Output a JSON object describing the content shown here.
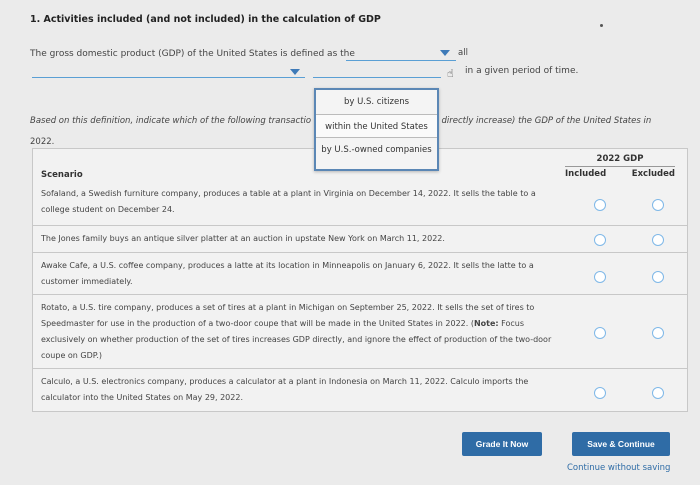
{
  "question": {
    "title": "1. Activities included (and not included) in the calculation of GDP",
    "sentence_start": "The gross domestic product (GDP) of the United States is defined as the",
    "dropdown_selected_all": "all",
    "sentence_end": "in a given period of time.",
    "instruction_start": "Based on this definition, indicate which of the following transactio",
    "instruction_end": ", directly increase) the GDP of the United States in",
    "instruction_year": "2022."
  },
  "dropdown": {
    "options": [
      "by U.S. citizens",
      "within the United States",
      "by U.S.-owned companies"
    ]
  },
  "table": {
    "header_year": "2022 GDP",
    "col_included": "Included",
    "col_excluded": "Excluded",
    "scenario_label": "Scenario",
    "rows": [
      {
        "text": "Sofaland, a Swedish furniture company, produces a table at a plant in Virginia on December 14, 2022. It sells the table to a college student on December 24."
      },
      {
        "text": "The Jones family buys an antique silver platter at an auction in upstate New York on March 11, 2022."
      },
      {
        "text": "Awake Cafe, a U.S. coffee company, produces a latte at its location in Minneapolis on January 6, 2022. It sells the latte to a customer immediately."
      },
      {
        "text": "Rotato, a U.S. tire company, produces a set of tires at a plant in Michigan on September 25, 2022. It sells the set of tires to Speedmaster for use in the production of a two-door coupe that will be made in the United States in 2022.",
        "note_label": "Note:",
        "note_text": " Focus exclusively on whether production of the set of tires increases GDP directly, and ignore the effect of production of the two-door coupe on GDP.)",
        "note_open": "("
      },
      {
        "text": "Calculo, a U.S. electronics company, produces a calculator at a plant in Indonesia on March 11, 2022. Calculo imports the calculator into the United States on May 29, 2022."
      }
    ]
  },
  "buttons": {
    "grade": "Grade It Now",
    "save": "Save & Continue",
    "continue_link": "Continue without saving"
  },
  "colors": {
    "accent": "#2f6ca6",
    "radio_border": "#7fb8e8",
    "background": "#ebebeb"
  }
}
